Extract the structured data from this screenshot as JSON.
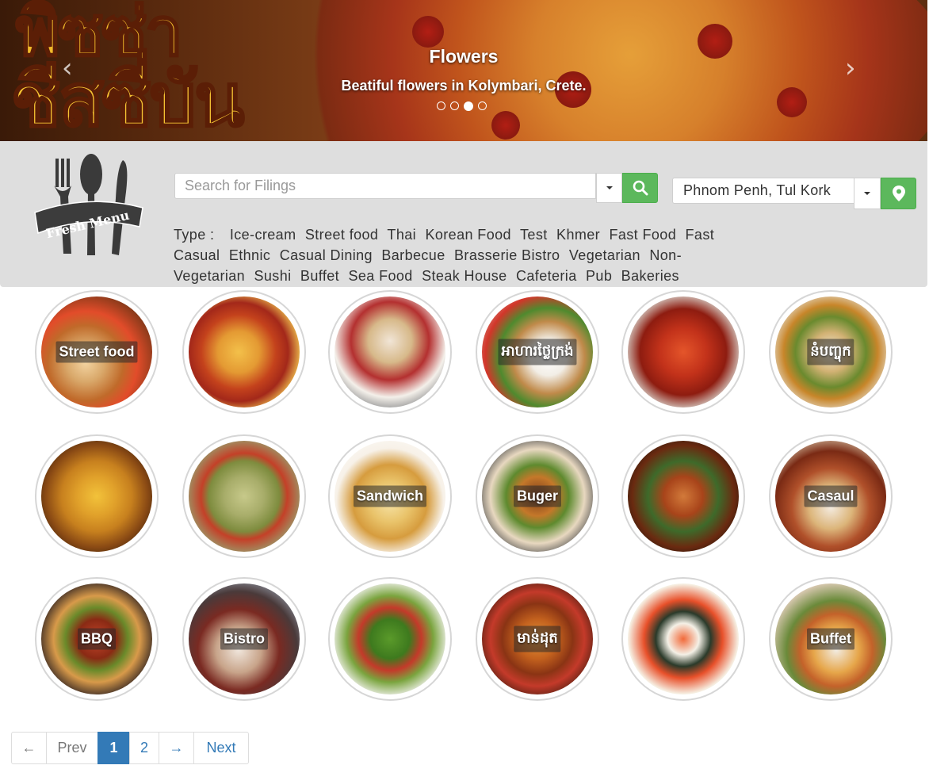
{
  "carousel": {
    "banner_text_line1": "พิซซ่า",
    "banner_text_line2": "ชีสซี่บัน",
    "caption_title": "Flowers",
    "caption_text": "Beatiful flowers in Kolymbari, Crete.",
    "indicator_count": 4,
    "active_indicator": 3,
    "prev_icon": "chevron-left-icon",
    "next_icon": "chevron-right-icon"
  },
  "logo": {
    "text": "Fresh Menu",
    "icon": "fork-spoon-knife-icon"
  },
  "search": {
    "placeholder": "Search for Filings",
    "button_icon": "search-icon"
  },
  "location": {
    "value": "Phnom Penh, Tul Kork",
    "button_icon": "map-marker-icon"
  },
  "types": {
    "label": "Type :",
    "items": [
      "Ice-cream",
      "Street food",
      "Thai",
      "Korean Food",
      "Test",
      "Khmer",
      "Fast Food",
      "Fast Casual",
      "Ethnic",
      "Casual Dining",
      "Barbecue",
      "Brasserie Bistro",
      "Vegetarian",
      "Non-Vegetarian",
      "Sushi",
      "Buffet",
      "Sea Food",
      "Steak House",
      "Cafeteria",
      "Pub",
      "Bakeries"
    ]
  },
  "categories": [
    {
      "label": "Street food",
      "photo": "street-food-skewers"
    },
    {
      "label": "",
      "photo": "pizza"
    },
    {
      "label": "",
      "photo": "ice-cream-cups"
    },
    {
      "label": "អាហារថ្លៃក្រង់",
      "photo": "rice-plate"
    },
    {
      "label": "",
      "photo": "crab"
    },
    {
      "label": "នំបញ្ចុក",
      "photo": "noodle-dishes"
    },
    {
      "label": "",
      "photo": "soup-with-corn"
    },
    {
      "label": "",
      "photo": "green-curry"
    },
    {
      "label": "Sandwich",
      "photo": "sandwich"
    },
    {
      "label": "Buger",
      "photo": "burgers"
    },
    {
      "label": "",
      "photo": "banquet-table"
    },
    {
      "label": "Casaul",
      "photo": "restaurant-table"
    },
    {
      "label": "BBQ",
      "photo": "grill"
    },
    {
      "label": "Bistro",
      "photo": "bistro-dining"
    },
    {
      "label": "",
      "photo": "salad"
    },
    {
      "label": "មាន់ដុត",
      "photo": "roast-chicken"
    },
    {
      "label": "",
      "photo": "sushi"
    },
    {
      "label": "Buffet",
      "photo": "buffet-dishes"
    }
  ],
  "pagination": {
    "first": "←",
    "prev": "Prev",
    "pages": [
      "1",
      "2"
    ],
    "active_page": "1",
    "last": "→",
    "next": "Next"
  },
  "colors": {
    "accent_green": "#5cb85c",
    "link_blue": "#337ab7",
    "header_bg": "#dedede"
  }
}
